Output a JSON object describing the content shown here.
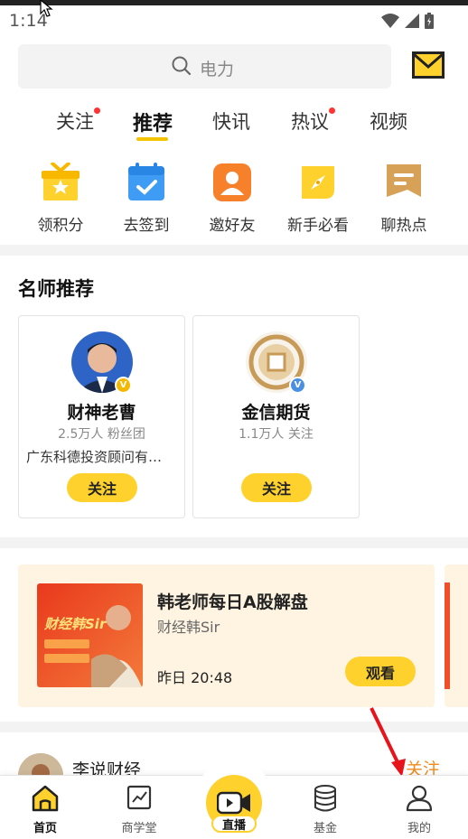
{
  "status_bar": {
    "time": "1:14"
  },
  "search": {
    "placeholder": "电力"
  },
  "tabs": [
    {
      "label": "关注",
      "has_dot": true
    },
    {
      "label": "推荐",
      "active": true
    },
    {
      "label": "快讯"
    },
    {
      "label": "热议",
      "has_dot": true
    },
    {
      "label": "视频"
    }
  ],
  "quick_actions": [
    {
      "label": "领积分",
      "icon": "gift-icon"
    },
    {
      "label": "去签到",
      "icon": "calendar-check-icon"
    },
    {
      "label": "邀好友",
      "icon": "invite-user-icon"
    },
    {
      "label": "新手必看",
      "icon": "compass-icon"
    },
    {
      "label": "聊热点",
      "icon": "chat-bubble-icon"
    }
  ],
  "teachers": {
    "title": "名师推荐",
    "cards": [
      {
        "name": "财神老曹",
        "fans": "2.5万人 粉丝团",
        "desc": "广东科德投资顾问有…",
        "button": "关注"
      },
      {
        "name": "金信期货",
        "fans": "1.1万人 关注",
        "desc": "",
        "button": "关注"
      }
    ]
  },
  "live": {
    "title": "韩老师每日A股解盘",
    "author": "财经韩Sir",
    "time": "昨日 20:48",
    "button": "观看",
    "thumb_brand": "财经韩Sir"
  },
  "post": {
    "name": "李说财经",
    "follow": "关注"
  },
  "bottom_nav": [
    {
      "label": "首页",
      "icon": "home-icon",
      "active": true
    },
    {
      "label": "商学堂",
      "icon": "chart-board-icon"
    },
    {
      "label": "直播",
      "icon": "video-camera-icon"
    },
    {
      "label": "基金",
      "icon": "coins-stack-icon"
    },
    {
      "label": "我的",
      "icon": "user-icon"
    }
  ],
  "colors": {
    "accent": "#fed12d",
    "follow_orange": "#f08a1a",
    "dot_red": "#ff3333"
  }
}
